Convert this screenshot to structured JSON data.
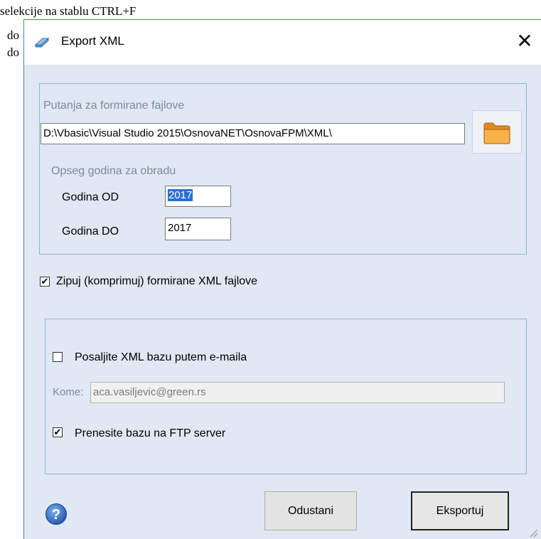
{
  "background": {
    "line1": "selekcije na stablu CTRL+F",
    "line2": "do",
    "line3": "do"
  },
  "dialog": {
    "title": "Export XML",
    "close_label": "✕",
    "path_group": {
      "label": "Putanja za formirane fajlove",
      "path_value": "D:\\Vbasic\\Visual Studio 2015\\OsnovaNET\\OsnovaFPM\\XML\\",
      "folder_icon": "folder-icon"
    },
    "years": {
      "label": "Opseg godina za obradu",
      "from_label": "Godina OD",
      "from_value": "2017",
      "to_label": "Godina DO",
      "to_value": "2017"
    },
    "zip_checkbox": {
      "label": "Zipuj (komprimuj) formirane XML fajlove",
      "checked": true
    },
    "email_checkbox": {
      "label": "Posaljite XML bazu putem e-maila",
      "checked": false
    },
    "recipient": {
      "label": "Kome:",
      "value": "aca.vasiljevic@green.rs"
    },
    "ftp_checkbox": {
      "label": "Prenesite bazu na FTP server",
      "checked": true
    },
    "cancel_button": "Odustani",
    "export_button": "Eksportuj",
    "help_icon": "help-icon",
    "check_mark": "✔"
  },
  "colors": {
    "dialog_bg": "#dfe8f3",
    "group_border": "#93b2d6",
    "selection": "#2e6fd4",
    "folder": "#f2a13a"
  }
}
